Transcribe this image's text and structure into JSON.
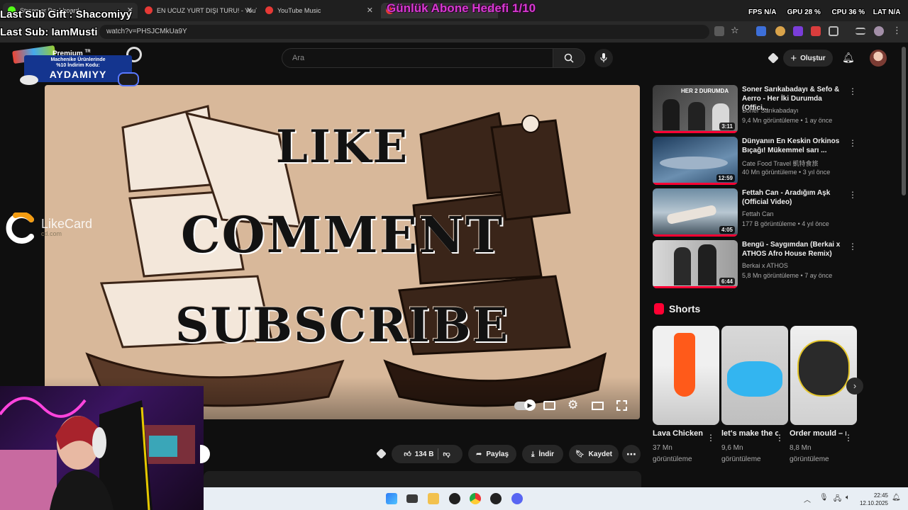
{
  "tabs": [
    {
      "label": "Streamer Dashboard"
    },
    {
      "label": "EN UCUZ YURT DIŞI TURU! - YouTube"
    },
    {
      "label": "YouTube Music"
    },
    {
      "label": "Günlük Abone Hedefi 1/10"
    }
  ],
  "address": {
    "url": "watch?v=PHSJCMkUa9Y"
  },
  "stream_overlay": {
    "last_sub_gift": "Last Sub Gift : Shacomiyy",
    "last_sub": "Last Sub: IamMusti",
    "goal": "Günlük Abone Hedefi 1/10",
    "sponsor_line1": "Machenike Ürünlerinde",
    "sponsor_line2": "%10 İndirim Kodu:",
    "sponsor_code": "AYDAMIYY",
    "likecard": "LikeCard",
    "likecard_sub": "cd.com",
    "premium": "Premium",
    "premium_tr": "TR"
  },
  "stats": {
    "fps_label": "FPS",
    "fps": "N/A",
    "gpu_label": "GPU",
    "gpu": "28 %",
    "cpu_label": "CPU",
    "cpu": "36 %",
    "lat_label": "LAT",
    "lat": "N/A"
  },
  "header": {
    "search_placeholder": "Ara",
    "create_label": "Oluştur"
  },
  "video": {
    "line1": "LIKE",
    "line2": "COMMENT",
    "line3": "SUBSCRIBE"
  },
  "actions": {
    "likes": "134 B",
    "share": "Paylaş",
    "download": "İndir",
    "save": "Kaydet"
  },
  "recommendations": [
    {
      "title": "Soner Sarıkabadayı & Sefo & Aerro - Her İki Durumda (Offici...",
      "channel": "Soner Sarıkabadayı",
      "views": "9,4 Mn görüntüleme",
      "age": "1 ay önce",
      "duration": "3:11",
      "thumb_text": "HER 2 DURUMDA"
    },
    {
      "title": "Dünyanın En Keskin Orkinos Bıçağı! Mükemmel sarı ...",
      "channel": "Cate Food Travel 凱特食旅",
      "views": "40 Mn görüntüleme",
      "age": "3 yıl önce",
      "duration": "12:59",
      "thumb_text": ""
    },
    {
      "title": "Fettah Can - Aradığım Aşk (Official Video)",
      "channel": "Fettah Can",
      "views": "177 B görüntüleme",
      "age": "4 yıl önce",
      "duration": "4:05",
      "thumb_text": ""
    },
    {
      "title": "Bengü - Saygımdan (Berkai x ATHOS Afro House Remix)",
      "channel": "Berkai x ATHOS",
      "views": "5,8 Mn görüntüleme",
      "age": "7 ay önce",
      "duration": "6:44",
      "thumb_text": ""
    }
  ],
  "shorts": {
    "heading": "Shorts",
    "items": [
      {
        "title": "Lava Chicken",
        "views": "37 Mn görüntüleme"
      },
      {
        "title": "let's make the cutest ...",
        "views": "9,6 Mn görüntüleme"
      },
      {
        "title": "Order mould – my inst ...",
        "views": "8,8 Mn görüntüleme"
      }
    ]
  },
  "clock": {
    "time": "22:45",
    "date": "12.10.2025"
  },
  "colors": {
    "yt_red": "#ff0033",
    "bg": "#0f0f0f",
    "overlay_pink": "#d63bd0",
    "taskbar": "#e8eef4"
  }
}
